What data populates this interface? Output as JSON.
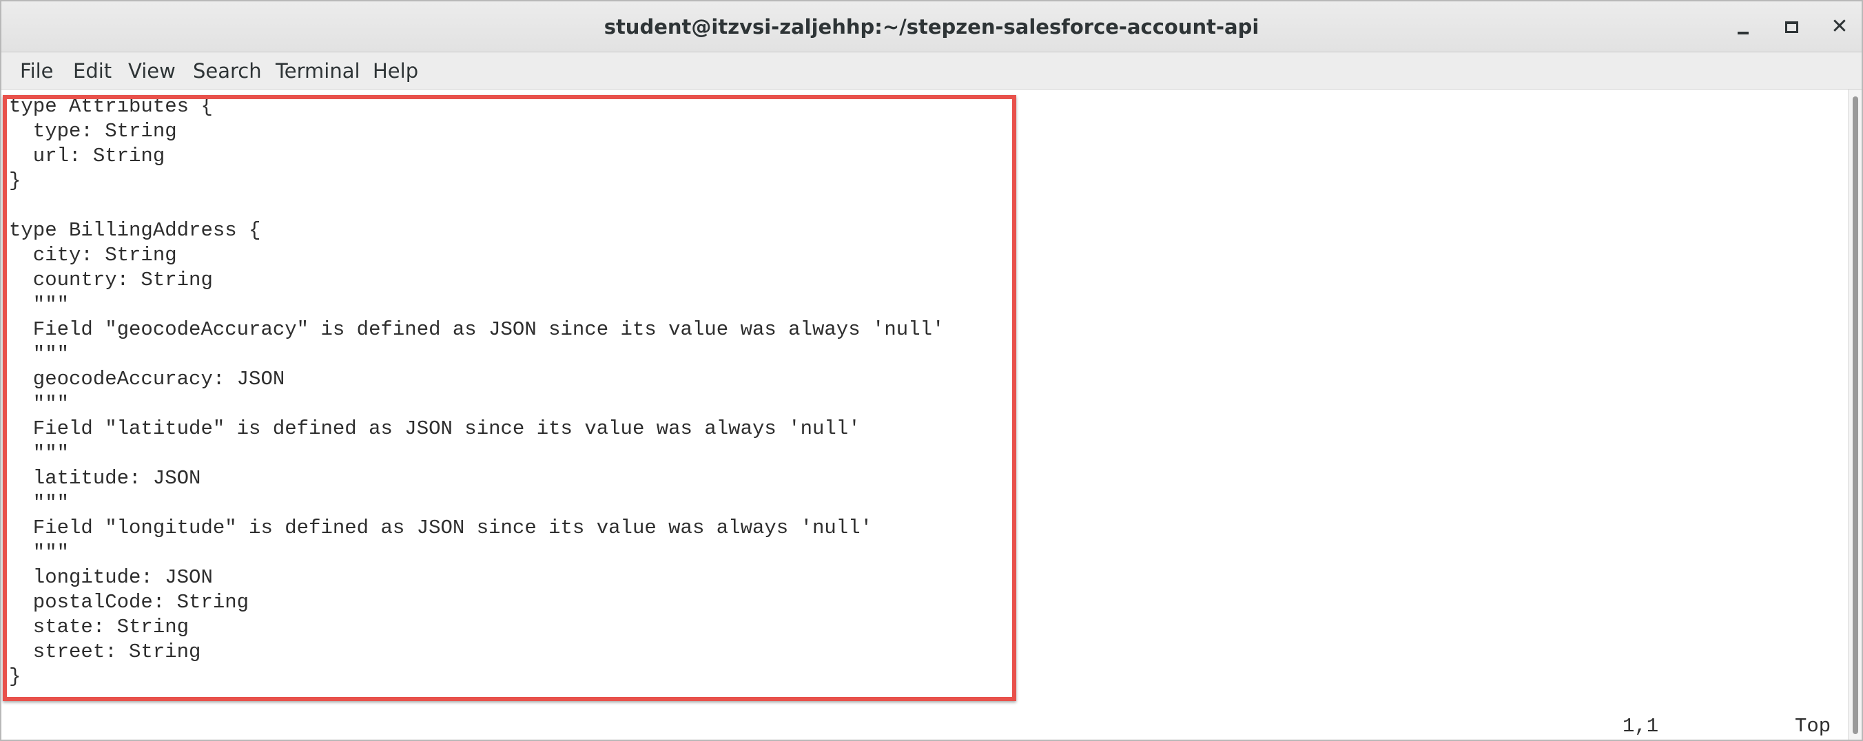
{
  "window": {
    "title": "student@itzvsi-zaljehhp:~/stepzen-salesforce-account-api",
    "controls": {
      "minimize_icon": "minimize-icon",
      "maximize_icon": "maximize-icon",
      "close_icon": "close-icon",
      "close_glyph": "✕"
    }
  },
  "menubar": {
    "items": [
      "File",
      "Edit",
      "View",
      "Search",
      "Terminal",
      "Help"
    ]
  },
  "terminal": {
    "lines": [
      "type Attributes {",
      "  type: String",
      "  url: String",
      "}",
      "",
      "type BillingAddress {",
      "  city: String",
      "  country: String",
      "  \"\"\"",
      "  Field \"geocodeAccuracy\" is defined as JSON since its value was always 'null'",
      "  \"\"\"",
      "  geocodeAccuracy: JSON",
      "  \"\"\"",
      "  Field \"latitude\" is defined as JSON since its value was always 'null'",
      "  \"\"\"",
      "  latitude: JSON",
      "  \"\"\"",
      "  Field \"longitude\" is defined as JSON since its value was always 'null'",
      "  \"\"\"",
      "  longitude: JSON",
      "  postalCode: String",
      "  state: String",
      "  street: String",
      "}"
    ],
    "status": {
      "cursor_position": "1,1",
      "scroll_position": "Top"
    }
  },
  "colors": {
    "highlight_border": "#e8514b",
    "titlebar_bg": "#e6e6e6",
    "text": "#2e2e2e"
  }
}
